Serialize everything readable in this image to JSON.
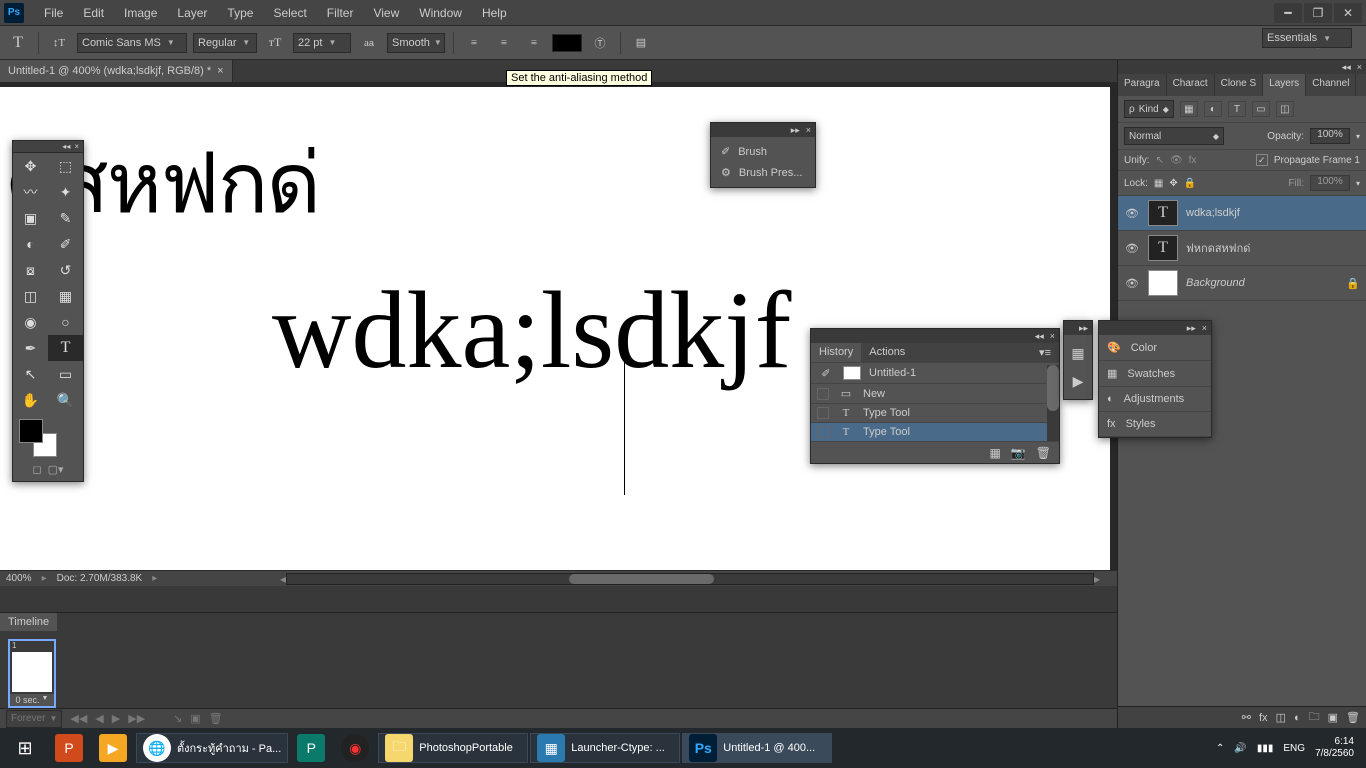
{
  "menubar": [
    "File",
    "Edit",
    "Image",
    "Layer",
    "Type",
    "Select",
    "Filter",
    "View",
    "Window",
    "Help"
  ],
  "options_bar": {
    "font_family": "Comic Sans MS",
    "font_style": "Regular",
    "font_size": "22 pt",
    "antialias": "Smooth",
    "tooltip": "Set the anti-aliasing method",
    "workspace": "Essentials"
  },
  "document": {
    "tab_title": "Untitled-1 @ 400% (wdka;lsdkjf, RGB/8) *",
    "zoom": "400%",
    "doc_size": "Doc: 2.70M/383.8K",
    "thai_text": "ดสหฟกด่",
    "main_text": "wdka;lsdkjf"
  },
  "brush_panel": {
    "items": [
      "Brush",
      "Brush Pres..."
    ]
  },
  "history_panel": {
    "tabs": [
      "History",
      "Actions"
    ],
    "doc": "Untitled-1",
    "rows": [
      {
        "icon": "▭",
        "label": "New",
        "active": false
      },
      {
        "icon": "T",
        "label": "Type Tool",
        "active": false
      },
      {
        "icon": "T",
        "label": "Type Tool",
        "active": true
      }
    ]
  },
  "right_dock_b": [
    "Color",
    "Swatches",
    "Adjustments",
    "Styles"
  ],
  "layers_panel": {
    "tabs": [
      "Paragra",
      "Charact",
      "Clone S",
      "Layers",
      "Channel"
    ],
    "kind": "Kind",
    "blend": "Normal",
    "opacity_label": "Opacity:",
    "opacity": "100%",
    "unify": "Unify:",
    "propagate": "Propagate Frame 1",
    "lock_label": "Lock:",
    "fill_label": "Fill:",
    "fill": "100%",
    "layers": [
      {
        "type": "T",
        "name": "wdka;lsdkjf",
        "active": true,
        "locked": false
      },
      {
        "type": "T",
        "name": "ฟหกดสหฟกด่",
        "active": false,
        "locked": false
      },
      {
        "type": "bg",
        "name": "Background",
        "active": false,
        "locked": true
      }
    ]
  },
  "timeline": {
    "title": "Timeline",
    "frame_duration": "0 sec.",
    "loop": "Forever"
  },
  "taskbar": {
    "items": [
      {
        "label": "ตั้งกระทู้คำถาม - Pa..."
      },
      {
        "label": "PhotoshopPortable"
      },
      {
        "label": "Launcher-Ctype: ..."
      },
      {
        "label": "Untitled-1 @ 400...",
        "active": true
      }
    ],
    "lang": "ENG",
    "time": "6:14",
    "date": "7/8/2560"
  }
}
